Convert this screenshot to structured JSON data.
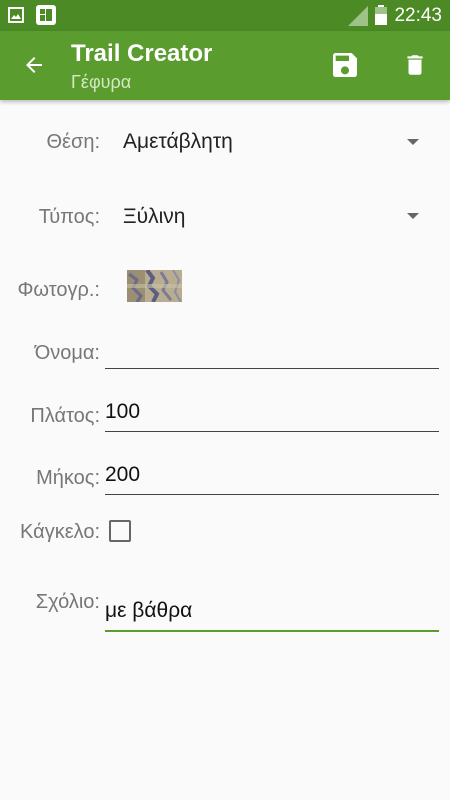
{
  "statusbar": {
    "time": "22:43",
    "icons": [
      "gallery-icon",
      "app-notification-icon",
      "signal-icon",
      "battery-icon"
    ]
  },
  "appbar": {
    "title": "Trail Creator",
    "subtitle": "Γέφυρα",
    "back_icon": "arrow-left-icon",
    "save_icon": "floppy-disk-icon",
    "delete_icon": "trash-icon"
  },
  "form": {
    "position": {
      "label": "Θέση:",
      "value": "Αμετάβλητη"
    },
    "type": {
      "label": "Τύπος:",
      "value": "Ξύλινη"
    },
    "photo": {
      "label": "Φωτογρ.:"
    },
    "name": {
      "label": "Όνομα:",
      "value": ""
    },
    "width": {
      "label": "Πλάτος:",
      "value": "100"
    },
    "length": {
      "label": "Μήκος:",
      "value": "200"
    },
    "railing": {
      "label": "Κάγκελο:",
      "checked": false
    },
    "comment": {
      "label": "Σχόλιο:",
      "value": "με βάθρα"
    }
  },
  "colors": {
    "statusbar": "#4b8a25",
    "appbar": "#5a9c2e",
    "accent": "#5a9c2e",
    "background": "#fafafa"
  }
}
